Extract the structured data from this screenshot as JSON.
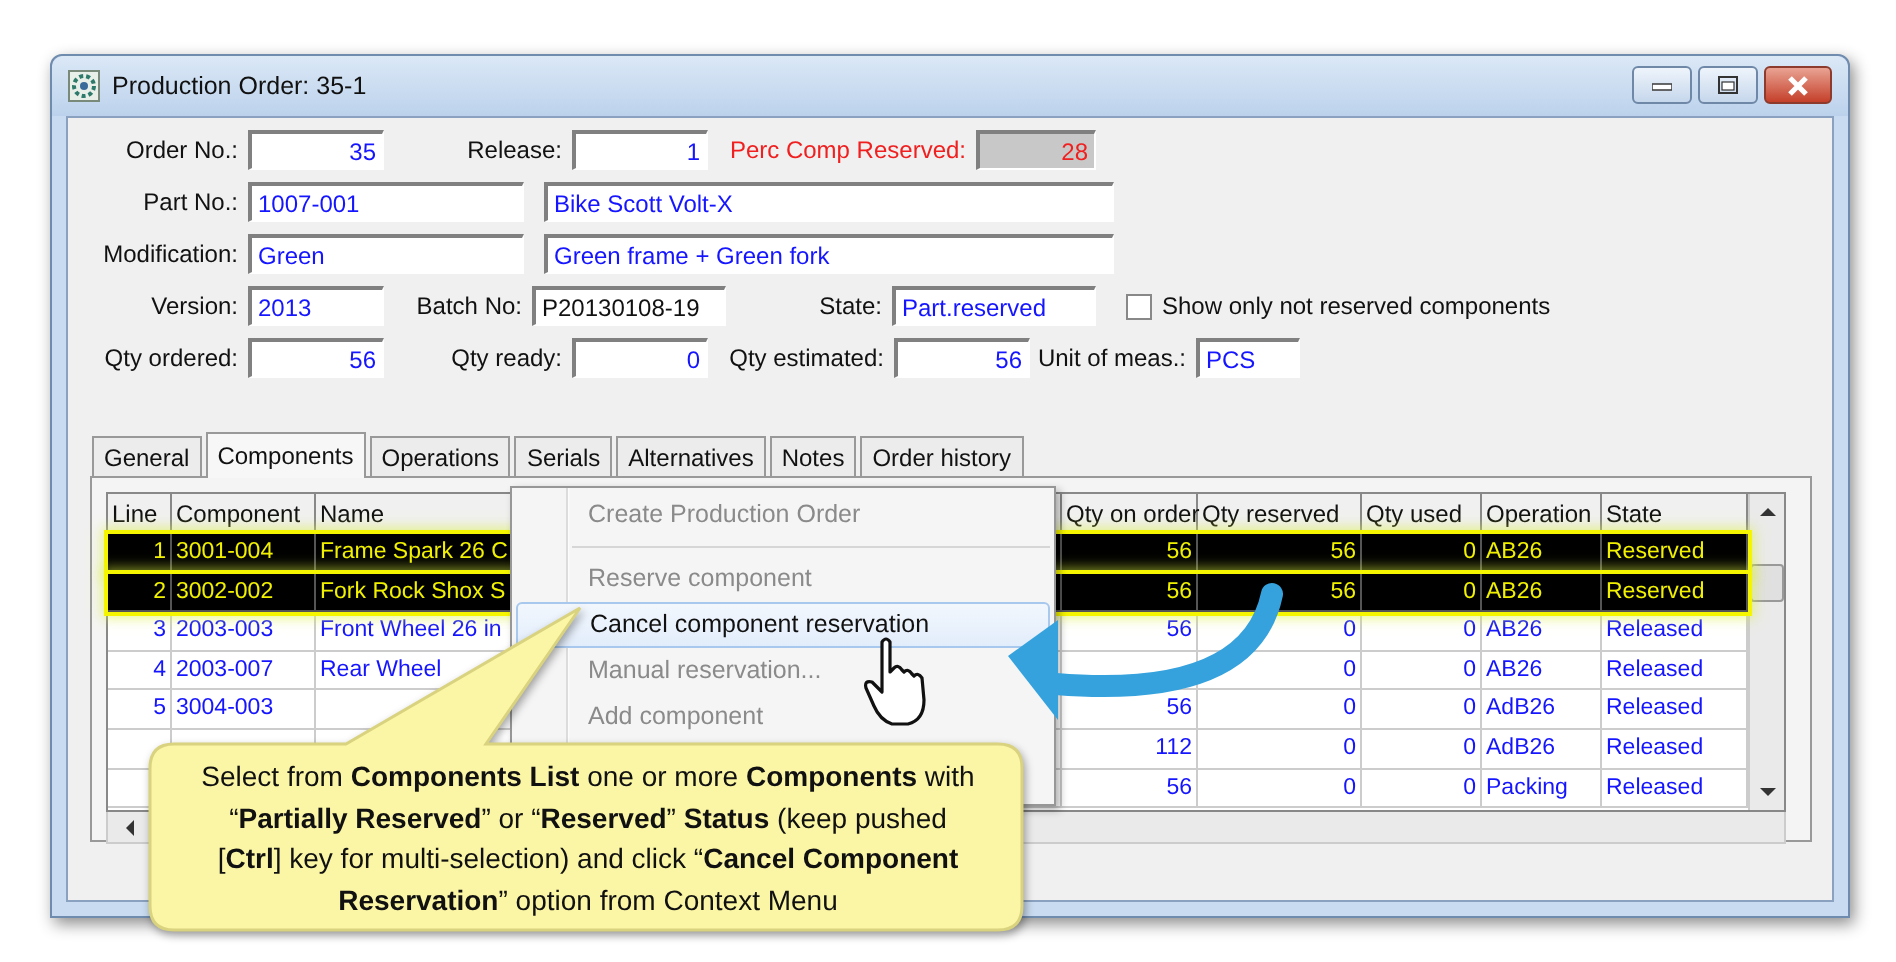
{
  "window": {
    "title": "Production Order: 35-1"
  },
  "form": {
    "order_no": {
      "label": "Order No.:",
      "value": "35"
    },
    "release": {
      "label": "Release:",
      "value": "1"
    },
    "perc_comp_reserved": {
      "label": "Perc Comp Reserved:",
      "value": "28",
      "disabled": true
    },
    "part_no": {
      "label": "Part No.:",
      "value": "1007-001"
    },
    "part_name": {
      "value": "Bike Scott Volt-X"
    },
    "modification": {
      "label": "Modification:",
      "value": "Green"
    },
    "modification_desc": {
      "value": "Green frame + Green fork"
    },
    "version": {
      "label": "Version:",
      "value": "2013"
    },
    "batch_no": {
      "label": "Batch No:",
      "value": "P20130108-19"
    },
    "state": {
      "label": "State:",
      "value": "Part.reserved"
    },
    "show_only_not_reserved": {
      "label": "Show only not reserved components",
      "checked": false
    },
    "qty_ordered": {
      "label": "Qty ordered:",
      "value": "56"
    },
    "qty_ready": {
      "label": "Qty ready:",
      "value": "0"
    },
    "qty_estimated": {
      "label": "Qty estimated:",
      "value": "56"
    },
    "unit": {
      "label": "Unit of meas.:",
      "value": "PCS"
    }
  },
  "tabs": [
    {
      "label": "General",
      "selected": false
    },
    {
      "label": "Components",
      "selected": true
    },
    {
      "label": "Operations",
      "selected": false
    },
    {
      "label": "Serials",
      "selected": false
    },
    {
      "label": "Alternatives",
      "selected": false
    },
    {
      "label": "Notes",
      "selected": false
    },
    {
      "label": "Order history",
      "selected": false
    }
  ],
  "table": {
    "columns": [
      "Line",
      "Component",
      "Name",
      "Qty on order",
      "Qty reserved",
      "Qty used",
      "Operation",
      "State"
    ],
    "rows": [
      {
        "selected": true,
        "cells": [
          "1",
          "3001-004",
          "Frame Spark 26 C",
          "56",
          "56",
          "0",
          "AB26",
          "Reserved"
        ]
      },
      {
        "selected": true,
        "cells": [
          "2",
          "3002-002",
          "Fork Rock Shox S",
          "56",
          "56",
          "0",
          "AB26",
          "Reserved"
        ]
      },
      {
        "selected": false,
        "cells": [
          "3",
          "2003-003",
          "Front Wheel 26 in",
          "56",
          "0",
          "0",
          "AB26",
          "Released"
        ]
      },
      {
        "selected": false,
        "cells": [
          "4",
          "2003-007",
          "Rear Wheel",
          null,
          "0",
          "0",
          "AB26",
          "Released"
        ]
      },
      {
        "selected": false,
        "cells": [
          "5",
          "3004-003",
          null,
          "56",
          "0",
          "0",
          "AdB26",
          "Released"
        ]
      },
      {
        "selected": false,
        "cells": [
          null,
          null,
          null,
          "112",
          "0",
          "0",
          "AdB26",
          "Released"
        ]
      },
      {
        "selected": false,
        "cells": [
          null,
          null,
          null,
          "56",
          "0",
          "0",
          "Packing",
          "Released"
        ]
      }
    ]
  },
  "context_menu": [
    {
      "kind": "item",
      "label": "Create Production Order",
      "disabled": true,
      "selected": false
    },
    {
      "kind": "separator"
    },
    {
      "kind": "item",
      "label": "Reserve component",
      "disabled": true,
      "selected": false
    },
    {
      "kind": "item",
      "label": "Cancel component reservation",
      "disabled": false,
      "selected": true
    },
    {
      "kind": "item",
      "label": "Manual reservation...",
      "disabled": true,
      "selected": false
    },
    {
      "kind": "item",
      "label": "Add component",
      "disabled": true,
      "selected": false
    }
  ],
  "callout": {
    "text": "Select from **Components List** one or more **Components** with “**Partially Reserved**” or “**Reserved**” **Status**  (keep pushed [**Ctrl**] key for multi-selection) and click “**Cancel Component Reservation**” option from Context Menu"
  }
}
